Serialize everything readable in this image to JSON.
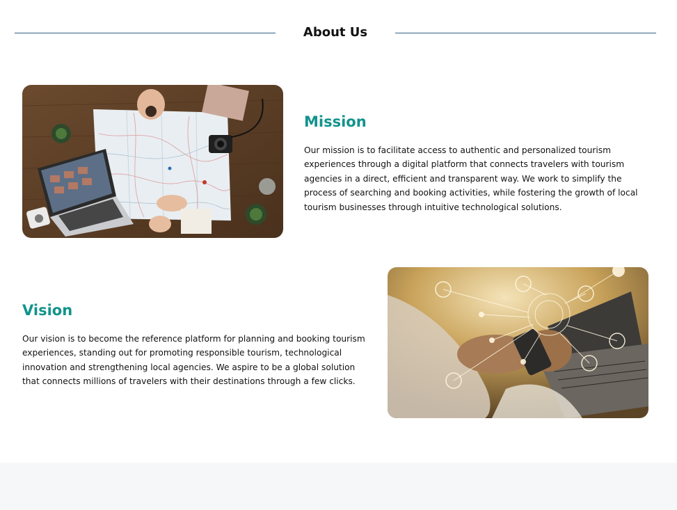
{
  "about": {
    "title": "About Us"
  },
  "mission": {
    "title": "Mission",
    "text": "Our mission is to facilitate access to authentic and personalized tourism experiences through a digital platform that connects travelers with tourism agencies in a direct, efficient and transparent way. We work to simplify the process of searching and booking activities, while fostering the growth of local tourism businesses through intuitive technological solutions."
  },
  "vision": {
    "title": "Vision",
    "text": "Our vision is to become the reference platform for planning and booking tourism experiences, standing out for promoting responsible tourism, technological innovation and strengthening local agencies. We aspire to be a global solution that connects millions of travelers with their destinations through a few clicks."
  },
  "colors": {
    "accent": "#12938c",
    "divider": "#2f5f86",
    "footer_band": "#f6f7f9"
  }
}
